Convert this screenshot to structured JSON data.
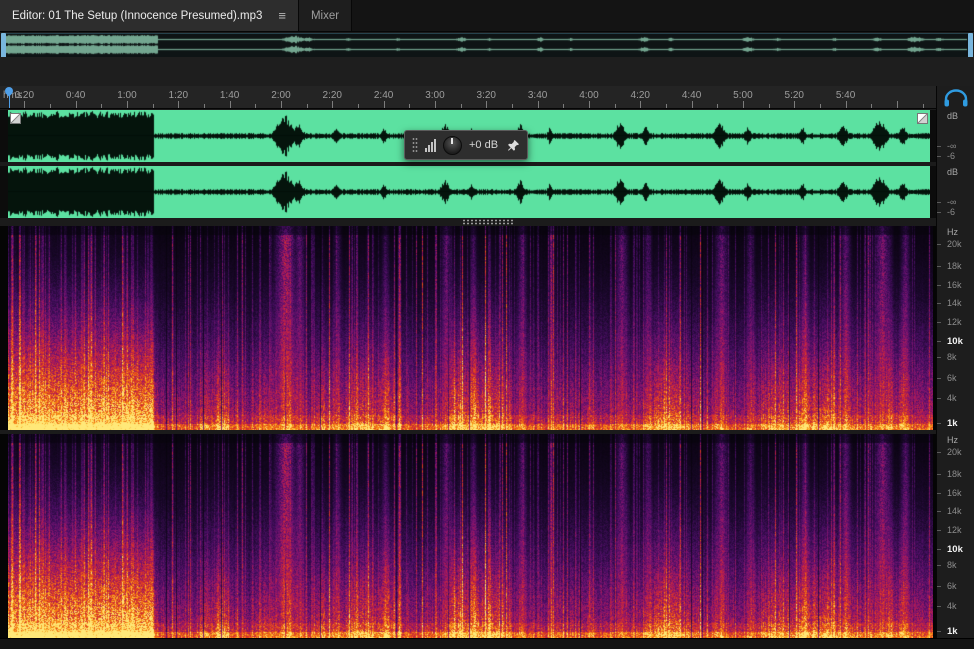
{
  "tabs": {
    "editor_label": "Editor: 01 The Setup (Innocence Presumed).mp3",
    "mixer_label": "Mixer",
    "menu_glyph": "≡"
  },
  "ruler": {
    "unit": "hms",
    "labels": [
      "0:20",
      "0:40",
      "1:00",
      "1:20",
      "1:40",
      "2:00",
      "2:20",
      "2:40",
      "3:00",
      "3:20",
      "3:40",
      "4:00",
      "4:20",
      "4:40",
      "5:00",
      "5:20",
      "5:40"
    ]
  },
  "hud": {
    "gain": "+0 dB"
  },
  "scales": {
    "waveform": {
      "unit": "dB",
      "labels": [
        "-∞",
        "-6"
      ]
    },
    "spectrogram": {
      "unit": "Hz",
      "labels": [
        "20k",
        "18k",
        "16k",
        "14k",
        "12k",
        "10k",
        "8k",
        "6k",
        "4k",
        "1k"
      ],
      "emphasized": [
        "10k",
        "1k"
      ]
    }
  },
  "colors": {
    "waveform_bg": "#5ce1a1",
    "waveform_ink": "#05140c",
    "playhead": "#4f9fe8",
    "navigator_handle": "#79b6dd",
    "monitor_icon": "#2f9be0",
    "spectrogram_low": "#1c0530",
    "spectrogram_hot": "#ffe878"
  },
  "icons": {
    "panel_menu": "hamburger-menu",
    "monitor": "headphones",
    "hud_meter": "level-meter-bars",
    "hud_knob": "gain-knob",
    "hud_pin": "pushpin"
  }
}
